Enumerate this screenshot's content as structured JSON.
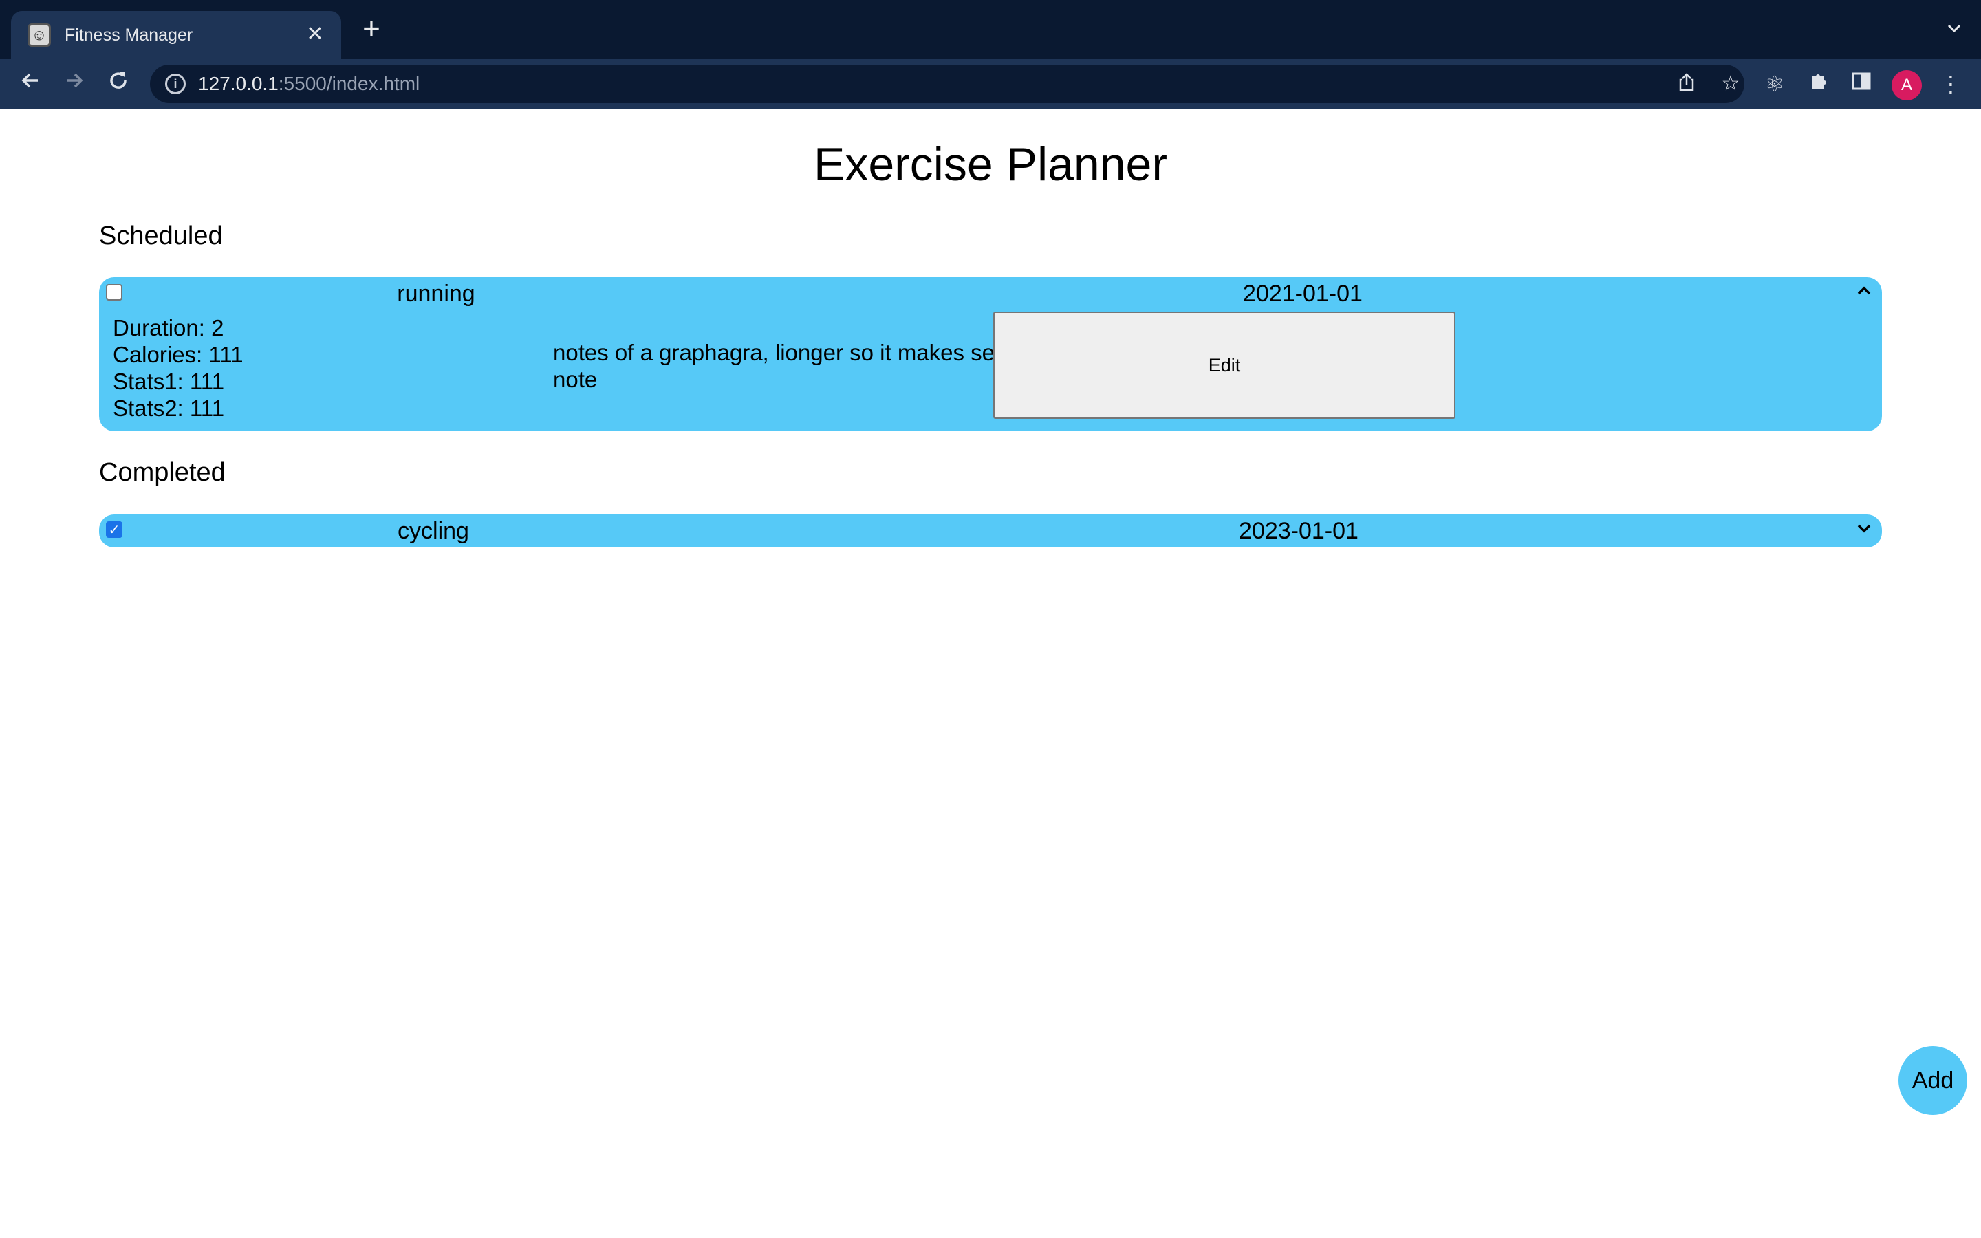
{
  "browser": {
    "tab_title": "Fitness Manager",
    "tab_close": "✕",
    "new_tab": "+",
    "tab_menu": "⌄",
    "url_host": "127.0.0.1",
    "url_rest": ":5500/index.html",
    "avatar_letter": "A"
  },
  "page": {
    "title": "Exercise Planner",
    "add_label": "Add"
  },
  "scheduled": {
    "heading": "Scheduled",
    "items": [
      {
        "checked": false,
        "name": "running",
        "date": "2021-01-01",
        "expanded": true,
        "duration": "Duration: 2",
        "calories": "Calories: 111",
        "stats1": "Stats1: 111",
        "stats2": "Stats2: 111",
        "notes": "notes of a graphagra, lionger so it makes sense as a note",
        "edit_label": "Edit"
      }
    ]
  },
  "completed": {
    "heading": "Completed",
    "items": [
      {
        "checked": true,
        "name": "cycling",
        "date": "2023-01-01",
        "expanded": false
      }
    ]
  },
  "colors": {
    "card_bg": "#56c9f7",
    "chrome_bg": "#0b1a33",
    "avatar_bg": "#d81b60"
  }
}
